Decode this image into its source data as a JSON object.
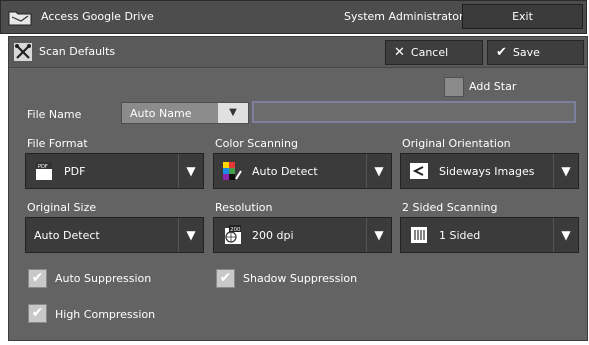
{
  "titlebar": {
    "app_title": "Access Google Drive",
    "user": "System Administrator",
    "exit_label": "Exit",
    "app_icon": "folder-icon"
  },
  "header": {
    "title": "Scan Defaults",
    "tool_icon": "tools-icon",
    "cancel_label": "Cancel",
    "save_label": "Save"
  },
  "add_star": {
    "label": "Add Star",
    "checked": false
  },
  "file_name": {
    "label": "File Name",
    "selected": "Auto Name",
    "input_value": ""
  },
  "file_format": {
    "label": "File Format",
    "value": "PDF",
    "icon": "pdf-icon"
  },
  "color_scanning": {
    "label": "Color Scanning",
    "value": "Auto Detect",
    "icon": "color-auto-icon"
  },
  "original_orientation": {
    "label": "Original Orientation",
    "value": "Sideways Images",
    "icon": "sideways-icon"
  },
  "original_size": {
    "label": "Original Size",
    "value": "Auto Detect"
  },
  "resolution": {
    "label": "Resolution",
    "value": "200 dpi",
    "icon_text": "200",
    "icon": "resolution-icon"
  },
  "two_sided": {
    "label": "2 Sided Scanning",
    "value": "1 Sided",
    "icon": "one-sided-icon"
  },
  "checkboxes": {
    "auto_suppression": {
      "label": "Auto Suppression",
      "checked": true
    },
    "shadow_suppression": {
      "label": "Shadow Suppression",
      "checked": true
    },
    "high_compression": {
      "label": "High Compression",
      "checked": true
    }
  },
  "colors": {
    "panel": "#636363",
    "titlebar": "#4d4d4d",
    "button": "#3b3b3b",
    "input_border": "#7d7f9c"
  }
}
